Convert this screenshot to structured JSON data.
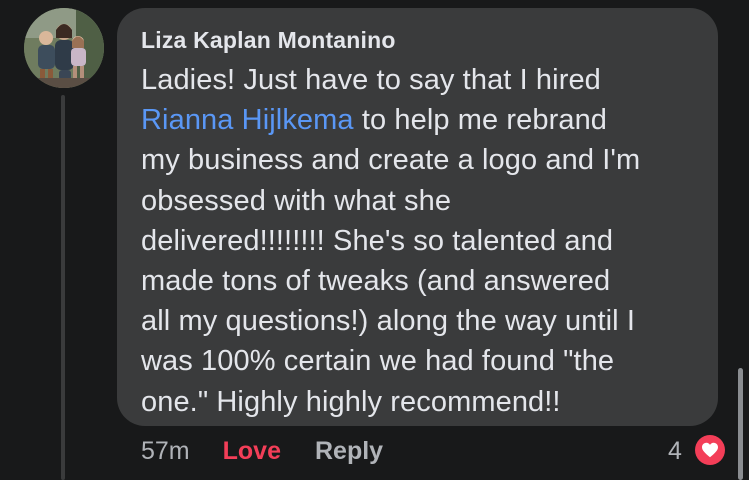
{
  "comment": {
    "author": "Liza Kaplan Montanino",
    "text_lines": [
      {
        "before": "Ladies! Just have to say that I hired",
        "mention": "",
        "after": ""
      },
      {
        "before": "",
        "mention": "Rianna Hijlkema",
        "after": " to help me rebrand"
      },
      {
        "before": "my business and create a logo and I'm",
        "mention": "",
        "after": ""
      },
      {
        "before": "obsessed with what she",
        "mention": "",
        "after": ""
      },
      {
        "before": "delivered!!!!!!!! She's so talented and",
        "mention": "",
        "after": ""
      },
      {
        "before": "made tons of tweaks (and answered",
        "mention": "",
        "after": ""
      },
      {
        "before": "all my questions!) along the way until I",
        "mention": "",
        "after": ""
      },
      {
        "before": "was 100% certain we had found \"the",
        "mention": "",
        "after": ""
      },
      {
        "before": "one.\" Highly highly recommend!!",
        "mention": "",
        "after": ""
      }
    ],
    "timestamp": "57m",
    "love_label": "Love",
    "reply_label": "Reply",
    "reaction_count": "4",
    "reaction_icon": "heart-icon"
  },
  "colors": {
    "background": "#18191a",
    "bubble": "#3a3b3c",
    "text": "#e4e6eb",
    "mention": "#5a97f5",
    "love": "#f33e58",
    "muted": "#b0b3b8"
  }
}
